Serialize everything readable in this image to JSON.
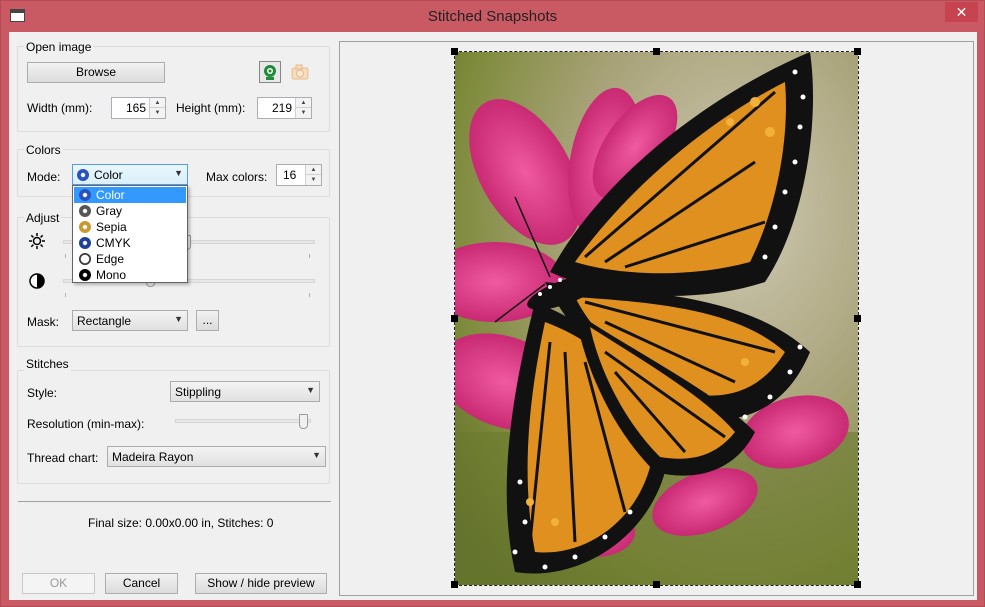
{
  "window": {
    "title": "Stitched Snapshots",
    "close_glyph": "✕"
  },
  "open_image": {
    "group_title": "Open image",
    "browse_label": "Browse",
    "width_label": "Width (mm):",
    "width_value": "165",
    "height_label": "Height (mm):",
    "height_value": "219",
    "camera_icon": "webcam-icon",
    "snapshot_icon": "camera-icon"
  },
  "colors": {
    "group_title": "Colors",
    "mode_label": "Mode:",
    "mode_value": "Color",
    "max_colors_label": "Max colors:",
    "max_colors_value": "16",
    "mode_options": [
      "Color",
      "Gray",
      "Sepia",
      "CMYK",
      "Edge",
      "Mono"
    ]
  },
  "adjust": {
    "group_title": "Adjust",
    "brightness_icon": "brightness-icon",
    "contrast_icon": "contrast-icon",
    "brightness_level": 0.49,
    "contrast_level": 0.34,
    "mask_label": "Mask:",
    "mask_value": "Rectangle",
    "mask_more_label": "..."
  },
  "stitches": {
    "group_title": "Stitches",
    "style_label": "Style:",
    "style_value": "Stippling",
    "resolution_label": "Resolution (min-max):",
    "resolution_level": 0.98,
    "thread_chart_label": "Thread chart:",
    "thread_chart_value": "Madeira Rayon"
  },
  "status": {
    "final_size": "Final size: 0.00x0.00 in, Stitches: 0"
  },
  "buttons": {
    "ok": "OK",
    "cancel": "Cancel",
    "preview": "Show / hide preview"
  },
  "colors_palette": {
    "accent": "#3399ff",
    "title_bar": "#c95a63",
    "close": "#c7434f"
  }
}
